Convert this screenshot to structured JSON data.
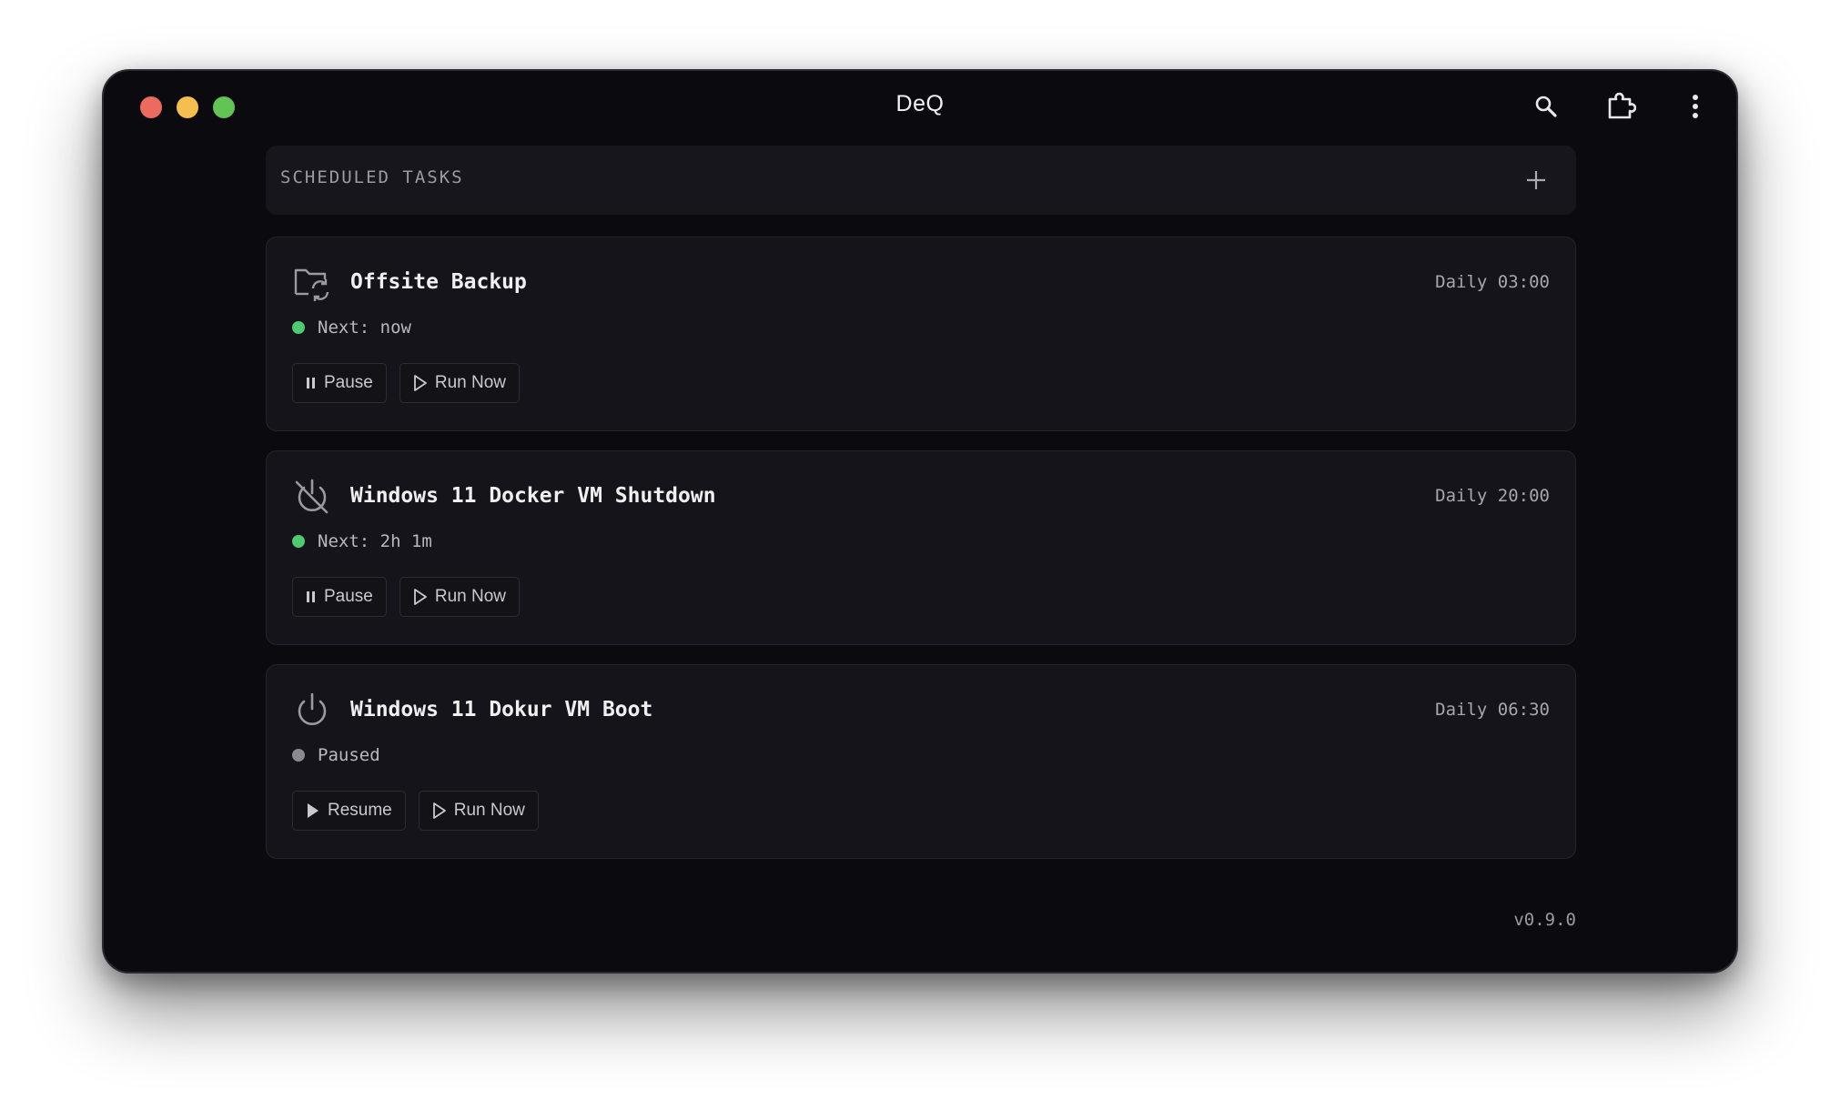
{
  "window": {
    "title": "DeQ",
    "version": "v0.9.0"
  },
  "toolbar": {
    "icons": [
      "search-icon",
      "extension-icon",
      "more-vertical-icon"
    ]
  },
  "section": {
    "title": "SCHEDULED TASKS",
    "add_icon": "plus-icon"
  },
  "tasks": [
    {
      "name": "Offsite Backup",
      "icon": "folder-sync-icon",
      "schedule": "Daily 03:00",
      "status": "Next: now",
      "status_color": "#4ecb71",
      "primary_icon": "pause-icon",
      "primary_label": "Pause",
      "run_label": "Run Now"
    },
    {
      "name": "Windows 11 Docker VM Shutdown",
      "icon": "power-off-icon",
      "schedule": "Daily 20:00",
      "status": "Next: 2h 1m",
      "status_color": "#4ecb71",
      "primary_icon": "pause-icon",
      "primary_label": "Pause",
      "run_label": "Run Now"
    },
    {
      "name": "Windows 11 Dokur VM Boot",
      "icon": "power-icon",
      "schedule": "Daily 06:30",
      "status": "Paused",
      "status_color": "#8a8a90",
      "primary_icon": "play-filled-icon",
      "primary_label": "Resume",
      "run_label": "Run Now"
    }
  ],
  "colors": {
    "background": "#0b0b0f",
    "card": "#14141a",
    "accent_green": "#4ecb71",
    "muted_gray": "#8a8a90"
  }
}
